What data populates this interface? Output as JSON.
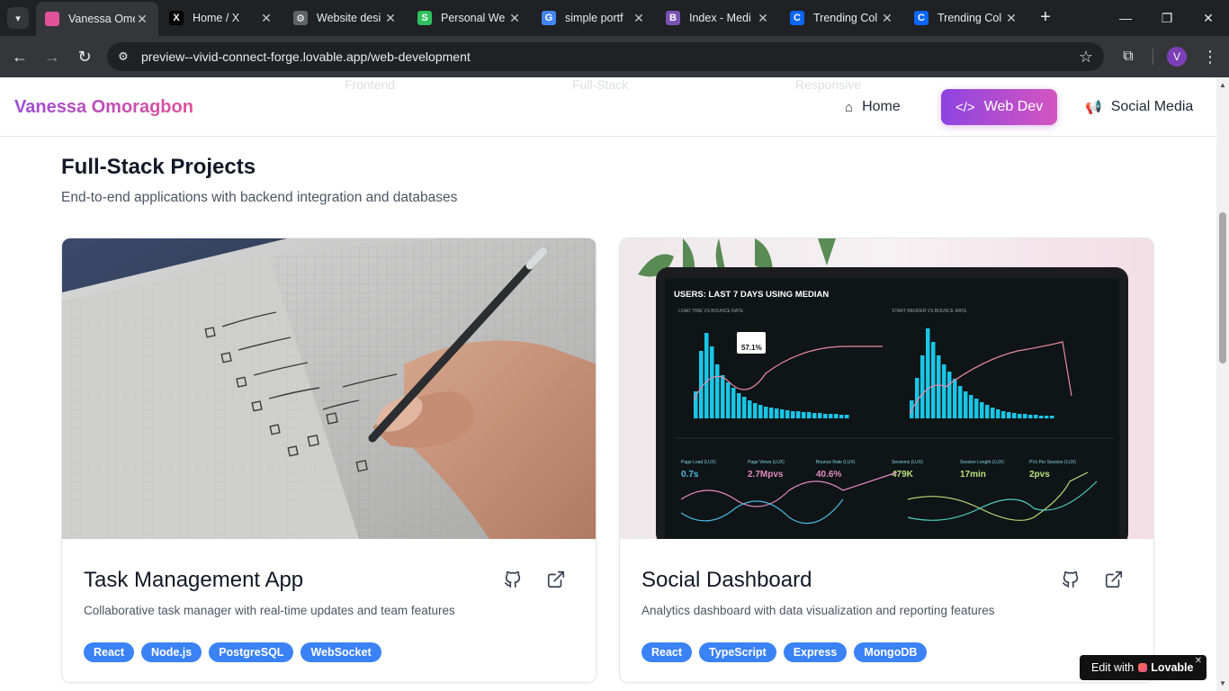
{
  "browser": {
    "tabs": [
      {
        "label": "Vanessa Omo",
        "icon": "lovable-heart-icon",
        "color": "#e0529a",
        "glyph": "",
        "active": true
      },
      {
        "label": "Home / X",
        "icon": "x-logo-icon",
        "color": "#000000",
        "glyph": "X",
        "active": false
      },
      {
        "label": "Website desi",
        "icon": "openai-icon",
        "color": "#5f6368",
        "glyph": "⚙",
        "active": false
      },
      {
        "label": "Personal We",
        "icon": "framer-icon",
        "color": "#2fbf5f",
        "glyph": "S",
        "active": false
      },
      {
        "label": "simple portf",
        "icon": "google-icon",
        "color": "#4285f4",
        "glyph": "G",
        "active": false
      },
      {
        "label": "Index - Medi",
        "icon": "bootstrap-icon",
        "color": "#7952b3",
        "glyph": "B",
        "active": false
      },
      {
        "label": "Trending Col",
        "icon": "coolors-icon",
        "color": "#0a66ff",
        "glyph": "C",
        "active": false
      },
      {
        "label": "Trending Col",
        "icon": "coolors-icon",
        "color": "#0a66ff",
        "glyph": "C",
        "active": false
      }
    ],
    "url_host": "preview--vivid-connect-forge.lovable.app",
    "url_path": "/web-development",
    "profile_initial": "V"
  },
  "navbar": {
    "brand": "Vanessa Omoragbon",
    "ghost_items": [
      "Frontend",
      "Full-Stack",
      "Responsive"
    ],
    "links": [
      {
        "label": "Home",
        "icon": "home-icon",
        "glyph": "⌂",
        "active": false
      },
      {
        "label": "Web Dev",
        "icon": "code-icon",
        "glyph": "</>",
        "active": true
      },
      {
        "label": "Social Media",
        "icon": "megaphone-icon",
        "glyph": "📢",
        "active": false
      }
    ]
  },
  "section": {
    "title": "Full-Stack Projects",
    "subtitle": "End-to-end applications with backend integration and databases"
  },
  "projects": [
    {
      "title": "Task Management App",
      "description": "Collaborative task manager with real-time updates and team features",
      "tags": [
        "React",
        "Node.js",
        "PostgreSQL",
        "WebSocket"
      ]
    },
    {
      "title": "Social Dashboard",
      "description": "Analytics dashboard with data visualization and reporting features",
      "tags": [
        "React",
        "TypeScript",
        "Express",
        "MongoDB"
      ],
      "screen": {
        "heading": "USERS: LAST 7 DAYS USING MEDIAN",
        "panel_left": "LOAD TIME VS BOUNCE RATE",
        "panel_right": "START RENDER VS BOUNCE RATE",
        "tooltip": "57.1%",
        "stats": [
          {
            "label": "Page Load (LUX)",
            "value": "0.7s"
          },
          {
            "label": "Page Views (LUX)",
            "value": "2.7Mpvs"
          },
          {
            "label": "Bounce Rate (LUX)",
            "value": "40.6%"
          },
          {
            "label": "Sessions (LUX)",
            "value": "479K"
          },
          {
            "label": "Session Length (LUX)",
            "value": "17min"
          },
          {
            "label": "PVs Per Session (LUX)",
            "value": "2pvs"
          }
        ]
      }
    }
  ],
  "badge": {
    "prefix": "Edit with",
    "brand": "Lovable"
  },
  "colors": {
    "accent_start": "#8e44e0",
    "accent_end": "#d455c0",
    "tag": "#3b82f6"
  }
}
